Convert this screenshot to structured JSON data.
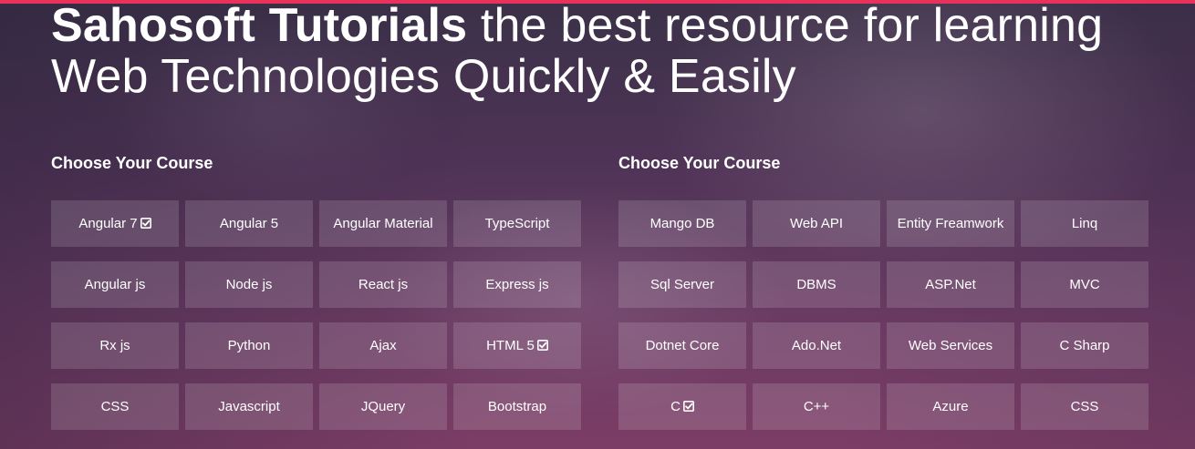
{
  "headline": {
    "brand": "Sahosoft Tutorials",
    "line1_rest": " the best resource for learning",
    "line2": "Web Technologies Quickly & Easily"
  },
  "columns": [
    {
      "title": "Choose Your Course",
      "courses": [
        {
          "label": "Angular 7",
          "checked": true
        },
        {
          "label": "Angular 5",
          "checked": false
        },
        {
          "label": "Angular Material",
          "checked": false
        },
        {
          "label": "TypeScript",
          "checked": false
        },
        {
          "label": "Angular js",
          "checked": false
        },
        {
          "label": "Node js",
          "checked": false
        },
        {
          "label": "React js",
          "checked": false
        },
        {
          "label": "Express js",
          "checked": false
        },
        {
          "label": "Rx js",
          "checked": false
        },
        {
          "label": "Python",
          "checked": false
        },
        {
          "label": "Ajax",
          "checked": false
        },
        {
          "label": "HTML 5",
          "checked": true
        },
        {
          "label": "CSS",
          "checked": false
        },
        {
          "label": "Javascript",
          "checked": false
        },
        {
          "label": "JQuery",
          "checked": false
        },
        {
          "label": "Bootstrap",
          "checked": false
        }
      ]
    },
    {
      "title": "Choose Your Course",
      "courses": [
        {
          "label": "Mango DB",
          "checked": false
        },
        {
          "label": "Web API",
          "checked": false
        },
        {
          "label": "Entity Freamwork",
          "checked": false
        },
        {
          "label": "Linq",
          "checked": false
        },
        {
          "label": "Sql Server",
          "checked": false
        },
        {
          "label": "DBMS",
          "checked": false
        },
        {
          "label": "ASP.Net",
          "checked": false
        },
        {
          "label": "MVC",
          "checked": false
        },
        {
          "label": "Dotnet Core",
          "checked": false
        },
        {
          "label": "Ado.Net",
          "checked": false
        },
        {
          "label": "Web Services",
          "checked": false
        },
        {
          "label": "C Sharp",
          "checked": false
        },
        {
          "label": "C",
          "checked": true
        },
        {
          "label": "C++",
          "checked": false
        },
        {
          "label": "Azure",
          "checked": false
        },
        {
          "label": "CSS",
          "checked": false
        }
      ]
    }
  ],
  "icons": {
    "checked": "check-square-icon"
  },
  "colors": {
    "accent_bar": "#e8315b",
    "text": "#ffffff",
    "button_bg": "rgba(255,255,255,0.14)"
  }
}
